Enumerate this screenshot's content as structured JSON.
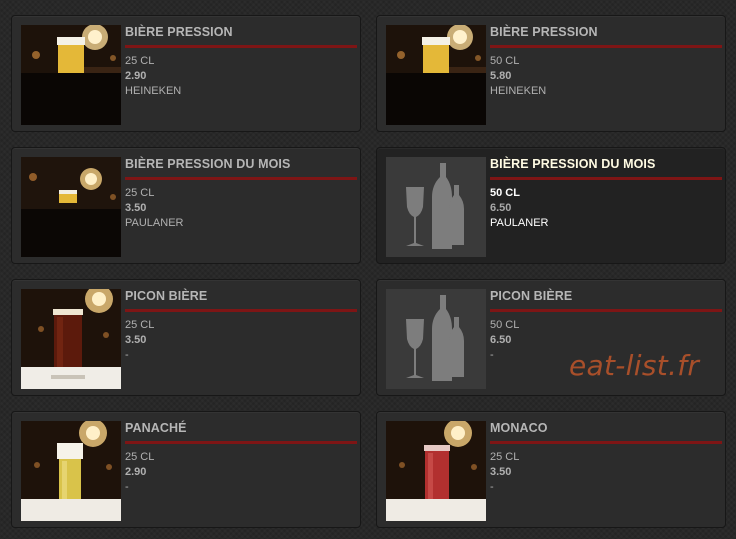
{
  "items": [
    {
      "name": "BIÈRE PRESSION",
      "size": "25 CL",
      "price": "2.90",
      "brand": "HEINEKEN",
      "image": "lager-bar-photo"
    },
    {
      "name": "BIÈRE PRESSION",
      "size": "50 CL",
      "price": "5.80",
      "brand": "HEINEKEN",
      "image": "lager-bar-photo"
    },
    {
      "name": "BIÈRE PRESSION DU MOIS",
      "size": "25 CL",
      "price": "3.50",
      "brand": "PAULANER",
      "image": "bar-wide-photo"
    },
    {
      "name": "BIÈRE PRESSION DU MOIS",
      "size": "50 CL",
      "price": "6.50",
      "brand": "PAULANER",
      "image": "bottles-placeholder-icon"
    },
    {
      "name": "PICON BIÈRE",
      "size": "25 CL",
      "price": "3.50",
      "brand": "-",
      "image": "dark-beer-photo"
    },
    {
      "name": "PICON BIÈRE",
      "size": "50 CL",
      "price": "6.50",
      "brand": "-",
      "image": "bottles-placeholder-icon"
    },
    {
      "name": "PANACHÉ",
      "size": "25 CL",
      "price": "2.90",
      "brand": "-",
      "image": "shandy-photo"
    },
    {
      "name": "MONACO",
      "size": "25 CL",
      "price": "3.50",
      "brand": "-",
      "image": "red-beer-photo"
    }
  ],
  "watermark": "eat-list.fr",
  "colors": {
    "accent_rule": "#7e1515",
    "card_bg": "#2c2c2c",
    "title_text": "#b6b6b6",
    "active_title_text": "#fffbe3",
    "watermark": "#a84f2a"
  }
}
